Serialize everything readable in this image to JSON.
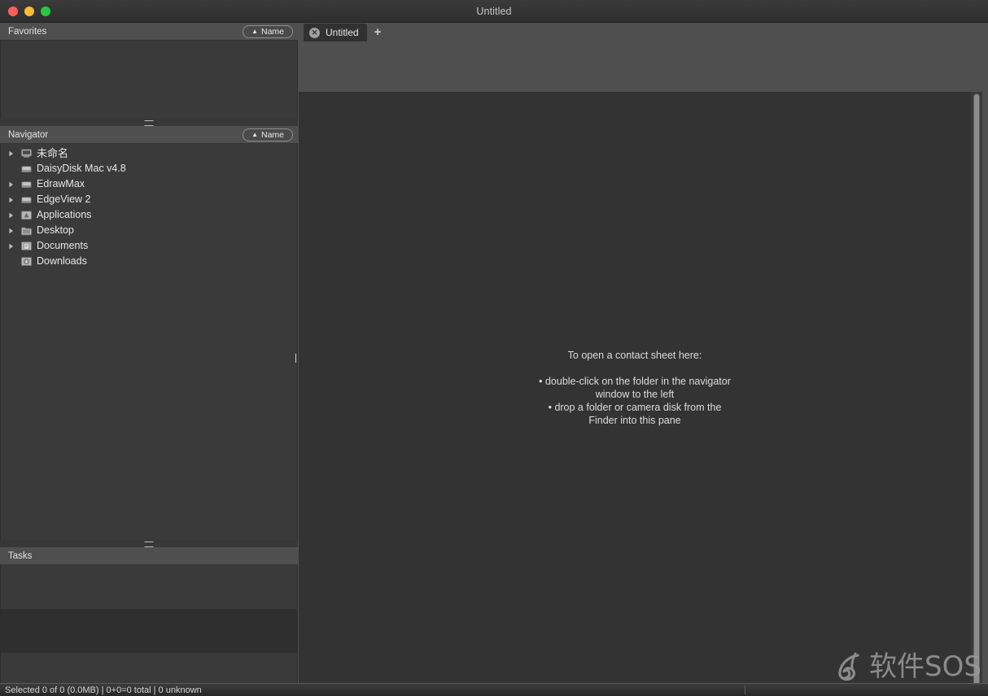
{
  "window": {
    "title": "Untitled",
    "traffic_lights": [
      {
        "name": "close",
        "color": "#ff5f56"
      },
      {
        "name": "minimize",
        "color": "#febc2e"
      },
      {
        "name": "zoom",
        "color": "#28c840"
      }
    ]
  },
  "favorites": {
    "header": "Favorites",
    "sort": {
      "caret": "▲",
      "label": "Name"
    },
    "items": []
  },
  "navigator": {
    "header": "Navigator",
    "sort": {
      "caret": "▲",
      "label": "Name"
    },
    "items": [
      {
        "label": "未命名",
        "icon": "computer-disk-icon",
        "expandable": true,
        "cjk": true
      },
      {
        "label": "DaisyDisk Mac v4.8",
        "icon": "disk-icon",
        "expandable": false,
        "cjk": false
      },
      {
        "label": "EdrawMax",
        "icon": "disk-icon",
        "expandable": true,
        "cjk": false
      },
      {
        "label": "EdgeView 2",
        "icon": "disk-icon",
        "expandable": true,
        "cjk": false
      },
      {
        "label": "Applications",
        "icon": "applications-folder-icon",
        "expandable": true,
        "cjk": false
      },
      {
        "label": "Desktop",
        "icon": "desktop-folder-icon",
        "expandable": true,
        "cjk": false
      },
      {
        "label": "Documents",
        "icon": "documents-folder-icon",
        "expandable": true,
        "cjk": false
      },
      {
        "label": "Downloads",
        "icon": "downloads-folder-icon",
        "expandable": false,
        "cjk": false
      }
    ]
  },
  "tasks": {
    "header": "Tasks",
    "items": []
  },
  "tabs": {
    "items": [
      {
        "label": "Untitled",
        "close_glyph": "✕",
        "active": true
      }
    ],
    "add_glyph": "+"
  },
  "content": {
    "empty_state": {
      "heading": "To open a contact sheet here:",
      "lines": [
        "• double-click on the folder in the navigator",
        "window to the left",
        "• drop a folder or camera disk from the",
        "Finder into this pane"
      ]
    }
  },
  "statusbar": {
    "text": "Selected 0 of 0 (0.0MB) | 0+0=0 total | 0 unknown"
  },
  "watermark": {
    "text": "软件SOS"
  }
}
